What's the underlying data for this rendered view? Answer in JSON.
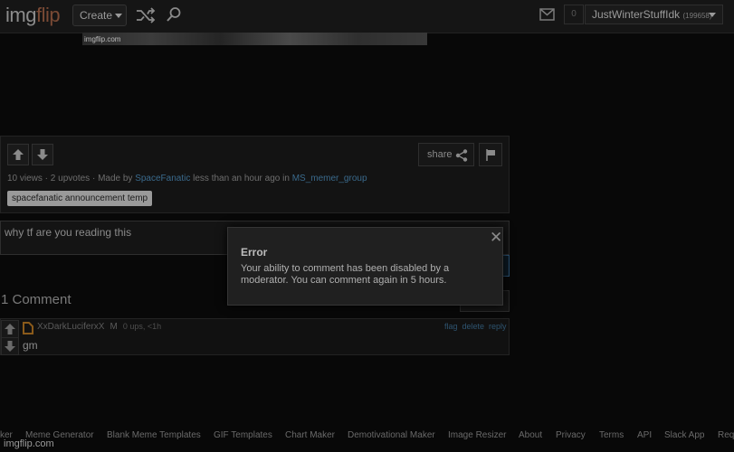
{
  "header": {
    "logo_main": "img",
    "logo_accent": "flip",
    "create_label": "Create",
    "notifications_count": "0",
    "username": "JustWinterStuffIdk",
    "user_points": "(199658)"
  },
  "meme": {
    "watermark": "imgflip.com"
  },
  "post": {
    "share_label": "share",
    "views": "10 views",
    "upvotes": "2 upvotes",
    "made_by_label": "Made by",
    "author": "SpaceFanatic",
    "time_ago": "less than an hour ago",
    "in_label": "in",
    "stream": "MS_memer_group",
    "tag": "spacefanatic announcement temp"
  },
  "comment_box": {
    "text": "why tf are you reading this"
  },
  "comments": {
    "title": "1 Comment",
    "items": [
      {
        "user": "XxDarkLuciferxX",
        "role": "M",
        "meta": "0 ups, <1h",
        "text": "gm",
        "actions": [
          "flag",
          "delete",
          "reply"
        ]
      }
    ]
  },
  "dialog": {
    "title": "Error",
    "message": "Your ability to comment has been disabled by a moderator. You can comment again in 5 hours.",
    "close": "✕"
  },
  "footer": {
    "links": [
      "ker",
      "Meme Generator",
      "Blank Meme Templates",
      "GIF Templates",
      "Chart Maker",
      "Demotivational Maker",
      "Image Resizer",
      "About",
      "Privacy",
      "Terms",
      "API",
      "Slack App",
      "Req"
    ],
    "watermark": "imgflip.com"
  },
  "colors": {
    "link": "#3a6a8c",
    "logo_accent": "#7a4a35",
    "tag_bg": "#9a9a9a"
  }
}
